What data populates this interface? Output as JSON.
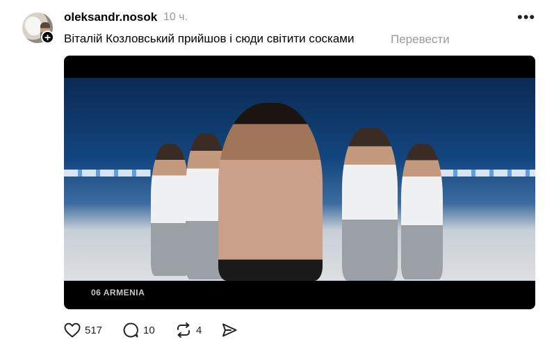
{
  "post": {
    "username": "oleksandr.nosok",
    "time": "10 ч.",
    "text": "Віталій Козловський прийшов і сюди світити сосками",
    "translate_label": "Перевести",
    "more_label": "•••",
    "avatar_plus": "+"
  },
  "video": {
    "caption": "06 ARMENIA"
  },
  "actions": {
    "likes": "517",
    "comments": "10",
    "reposts": "4"
  },
  "icons": {
    "like": "heart-icon",
    "comment": "comment-icon",
    "repost": "repost-icon",
    "share": "share-icon",
    "more": "more-icon",
    "follow": "plus-icon"
  }
}
